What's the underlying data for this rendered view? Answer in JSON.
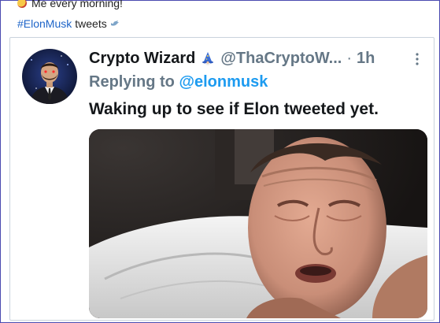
{
  "caption": {
    "text": "Me every morning!",
    "emoji": "face-emoji"
  },
  "hashtag_line": {
    "hashtag": "#ElonMusk",
    "suffix": "tweets",
    "icon": "bird-icon"
  },
  "tweet": {
    "display_name": "Crypto Wizard",
    "name_emoji": "wizard-icon",
    "handle": "@ThaCryptoW...",
    "separator": "·",
    "time": "1h",
    "replying_prefix": "Replying to",
    "replying_to": "@elonmusk",
    "text": "Waking up to see if Elon tweeted yet.",
    "colors": {
      "mention": "#1d9bf0",
      "hashtag": "#1d64c8",
      "muted": "#657786"
    }
  }
}
